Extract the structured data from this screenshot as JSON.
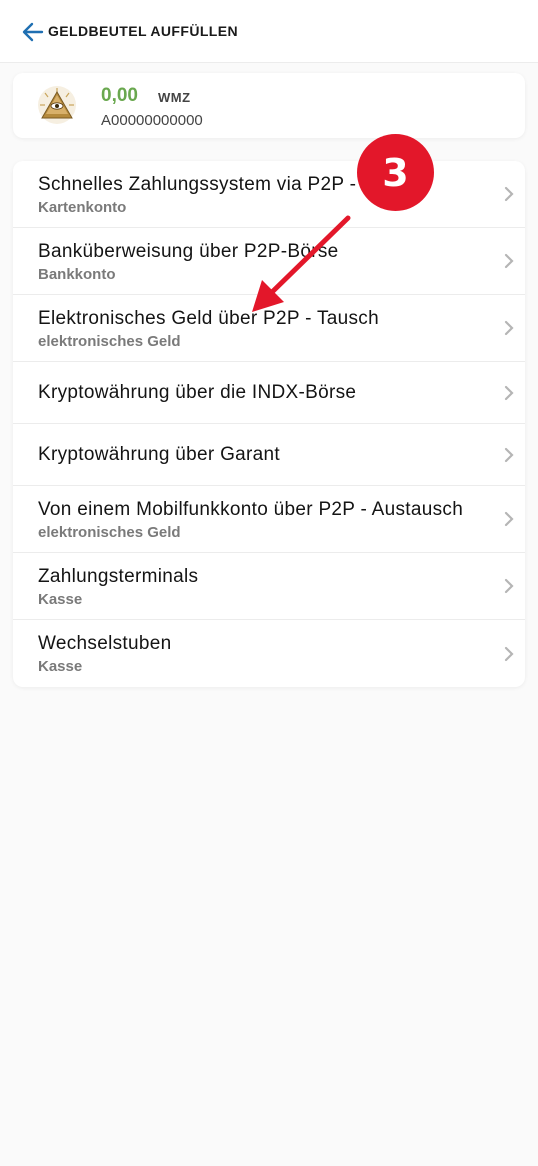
{
  "header": {
    "title": "GELDBEUTEL AUFFÜLLEN",
    "back_icon": "arrow-left-icon"
  },
  "wallet": {
    "amount": "0,00",
    "currency": "WMZ",
    "id": "A00000000000",
    "logo_icon": "pyramid-eye-logo"
  },
  "methods": [
    {
      "title": "Schnelles Zahlungssystem via P2P - Tausch",
      "subtitle": "Kartenkonto"
    },
    {
      "title": "Banküberweisung über P2P-Börse",
      "subtitle": "Bankkonto"
    },
    {
      "title": "Elektronisches Geld über P2P - Tausch",
      "subtitle": "elektronisches Geld"
    },
    {
      "title": "Kryptowährung über die INDX-Börse",
      "subtitle": ""
    },
    {
      "title": "Kryptowährung über Garant",
      "subtitle": ""
    },
    {
      "title": "Von einem Mobilfunkkonto über P2P - Austausch",
      "subtitle": "elektronisches Geld"
    },
    {
      "title": "Zahlungsterminals",
      "subtitle": "Kasse"
    },
    {
      "title": "Wechselstuben",
      "subtitle": "Kasse"
    }
  ],
  "annotation": {
    "step_number": "3",
    "color": "#e3172a"
  },
  "colors": {
    "accent_blue": "#1f6fb2",
    "amount_green": "#6aa84f"
  }
}
